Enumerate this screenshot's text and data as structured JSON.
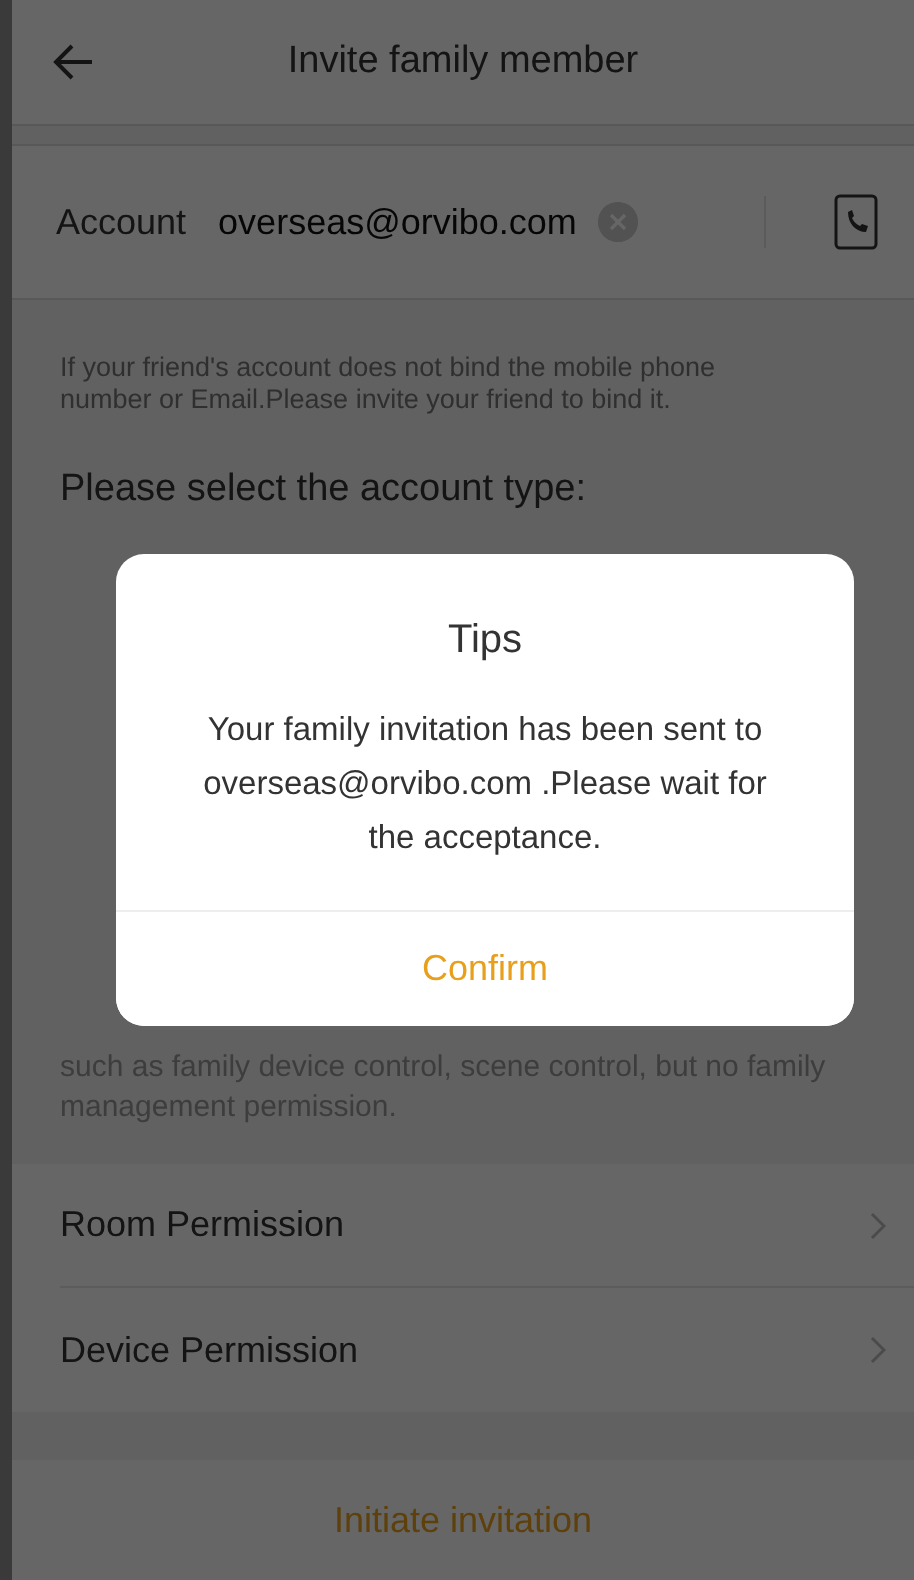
{
  "header": {
    "title": "Invite family member"
  },
  "account": {
    "label": "Account",
    "value": "overseas@orvibo.com"
  },
  "hint": "If your friend's account does not bind the mobile phone number or Email.Please invite your friend to bind it.",
  "account_type_prompt": "Please select the account type:",
  "member_description": "such as family device control, scene control, but no family management permission.",
  "permission_rows": [
    {
      "label": "Room Permission"
    },
    {
      "label": "Device Permission"
    }
  ],
  "primary_button": "Initiate invitation",
  "dialog": {
    "title": "Tips",
    "message": "Your family invitation has been sent to overseas@orvibo.com .Please wait for the acceptance.",
    "confirm": "Confirm"
  }
}
